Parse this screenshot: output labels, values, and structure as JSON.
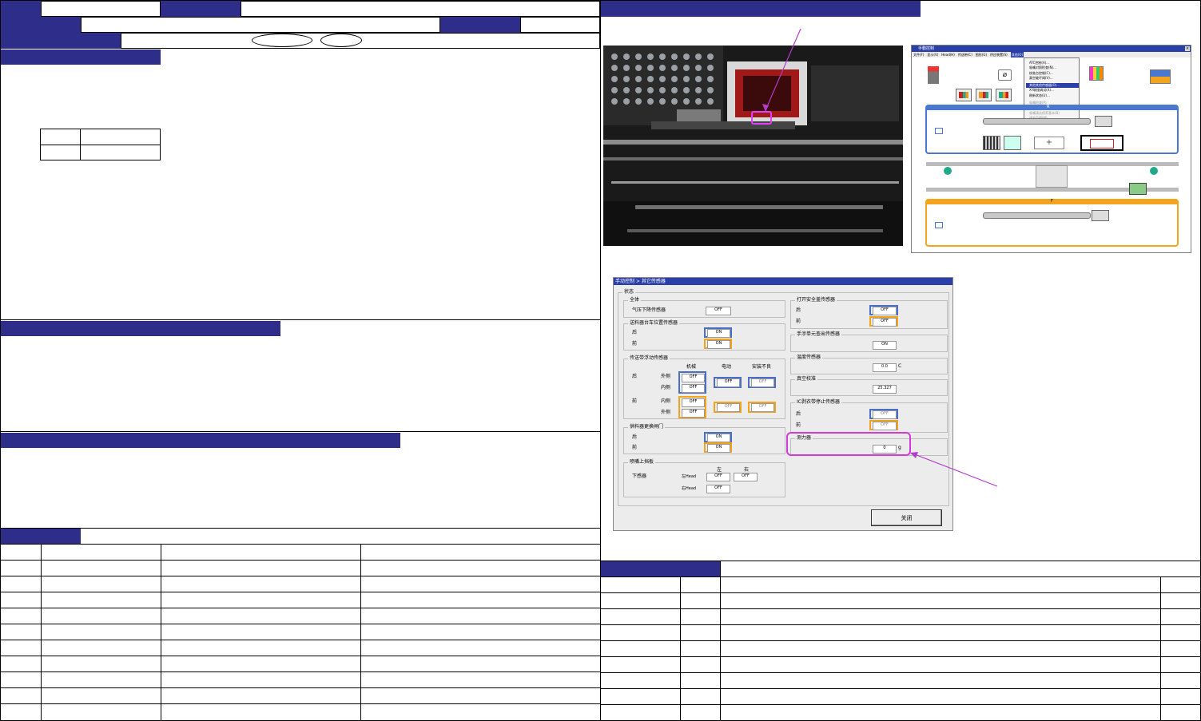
{
  "right_header": {
    "bar": ""
  },
  "photo_label": "",
  "manual_window": {
    "title": "手動控制",
    "menu": [
      "文件(F)",
      "显示(V)",
      "Head(H)",
      "传送带(C)",
      "图形(G)",
      "供应装置(S)",
      "其他(O)"
    ],
    "dropdown_items": [
      "ATC控制(A)...",
      "吸嘴对照检查(N)...",
      "校准台控制(C)...",
      "真空破坏阀(V)...",
      "其他其他传感器(O)...",
      "XY联接调试(X)...",
      "刷新状态(U)...",
      "吸嘴检查(P)",
      "IC吸嘴吸附量调整(I)",
      "吸嘴清洁保养基本(B)",
      "调节监视(M)"
    ],
    "panel_top_label": "R",
    "panel_bottom_label": "F"
  },
  "sensor_dialog": {
    "title": "手动控制 > 其它传感器",
    "close_button": "关闭",
    "status_group": "状态",
    "groups": {
      "overall": {
        "title": "全体",
        "row_label": "气压下降传感器",
        "value": "OFF"
      },
      "feeder_plate": {
        "title": "送料器台车位置传感器",
        "rear_label": "后",
        "rear_value": "ON",
        "front_label": "前",
        "front_value": "ON"
      },
      "conveyor": {
        "title": "传送带浮动传感器",
        "col1": "机械",
        "col2": "电动",
        "col3": "安装不良",
        "rear_label": "后",
        "front_label": "前",
        "outer": "外侧",
        "inner": "内侧",
        "rear_outer": "OFF",
        "rear_inner": "OFF",
        "rear_elec": "OFF",
        "rear_bad": "OFF",
        "front_inner": "OFF",
        "front_outer": "OFF",
        "front_elec": "OFF",
        "front_bad": "OFF"
      },
      "exchange_door": {
        "title": "供料器更换闸门",
        "rear_label": "后",
        "rear_value": "ON",
        "front_label": "前",
        "front_value": "ON"
      },
      "nozzle_head": {
        "title": "喷嘴上挡板",
        "col_left": "左",
        "col_right": "右",
        "row_label": "下感器",
        "left_head": "左Head",
        "right_head": "右Head",
        "lh_l": "OFF",
        "lh_r": "OFF",
        "rh_l": "OFF"
      },
      "safety_cover": {
        "title": "打开安全盖传感器",
        "rear_label": "后",
        "rear_value": "OFF",
        "front_label": "前",
        "front_value": "OFF"
      },
      "hand_unit": {
        "title": "手涉单元查出传感器",
        "value": "ON"
      },
      "temperature": {
        "title": "温度传感器",
        "value": "0.0",
        "unit": "C"
      },
      "vacuum": {
        "title": "真空校准",
        "value": "25.327"
      },
      "ic_stop": {
        "title": "IC剥衣带停止传感器",
        "rear_label": "后",
        "rear_value": "OFF",
        "front_label": "前",
        "front_value": "OFF"
      },
      "force": {
        "title": "测力器",
        "value": "0",
        "unit": "g"
      }
    }
  },
  "colors": {
    "navy": "#2e2e8a",
    "magenta": "#b23ccc",
    "blue_hl": "#4a6fc7",
    "orange_hl": "#f2a51c"
  }
}
